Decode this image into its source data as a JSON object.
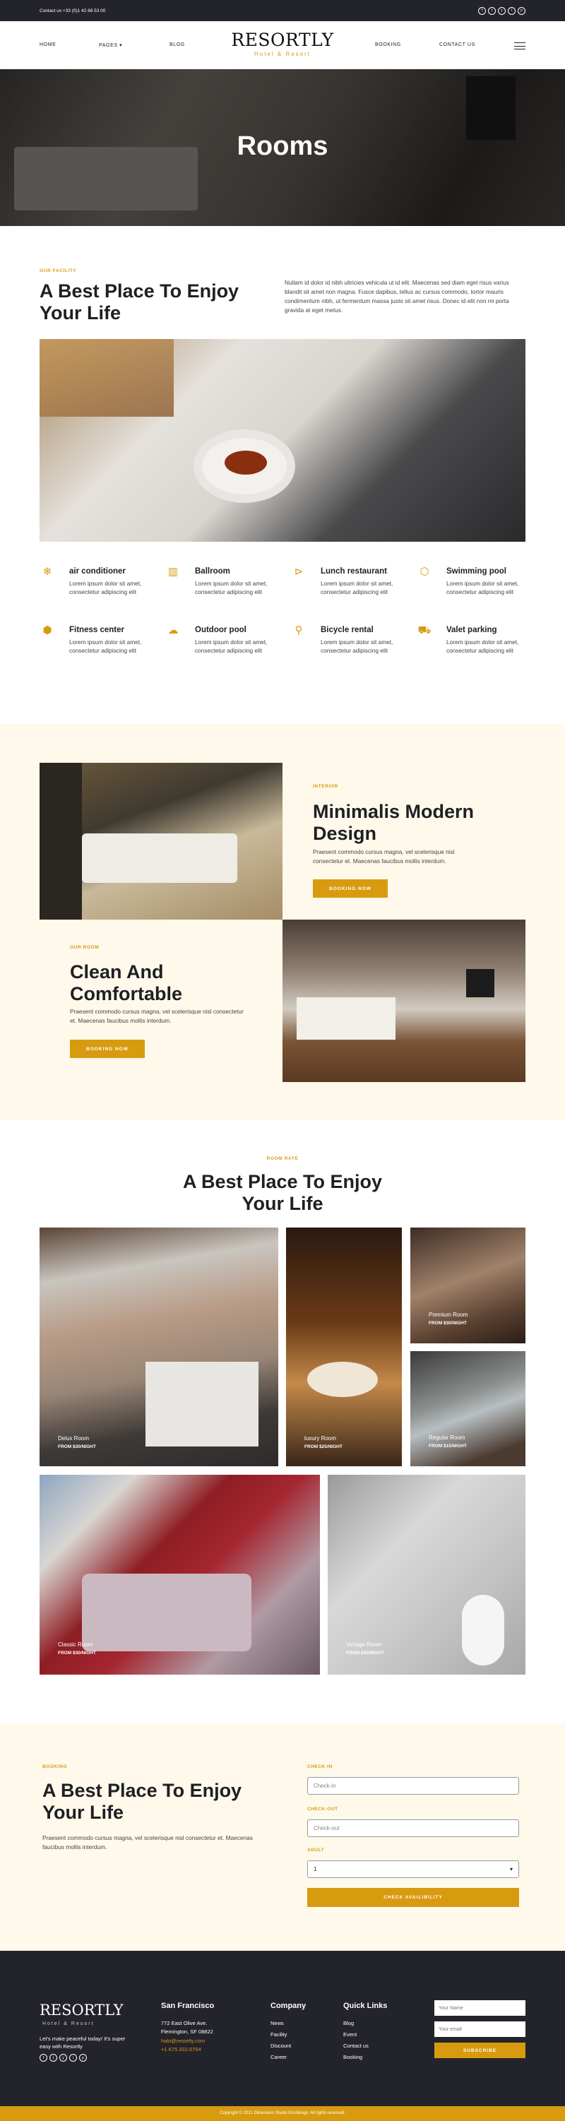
{
  "topbar": {
    "contact": "Contact us +33 (0)1 42 68 53 00",
    "socials": [
      "f",
      "t",
      "y",
      "i",
      "p"
    ]
  },
  "nav": {
    "home": "HOME",
    "pages": "PAGES",
    "blog": "BLOG",
    "booking": "BOOKING",
    "contact": "CONTACT US",
    "logo_name": "RESORTLY",
    "logo_tagline": "Hotel & Resort"
  },
  "hero": {
    "title": "Rooms"
  },
  "facility": {
    "tag": "OUR FACILITY",
    "title": "A Best Place To Enjoy Your Life",
    "text": "Nullam id dolor id nibh ultricies vehicula ut id elit. Maecenas sed diam eget risus varius blandit sit amet non magna. Fusce dapibus, tellus ac cursus commodo, tortor mauris condimentum nibh, ut fermentum massa justo sit amet risus. Donec id elit non mi porta gravida at eget metus.",
    "features": [
      {
        "icon": "snowflake-icon",
        "glyph": "❄",
        "title": "air conditioner",
        "desc": "Lorem ipsum dolor sit amet, consectetur adipiscing elit"
      },
      {
        "icon": "building-icon",
        "glyph": "▥",
        "title": "Ballroom",
        "desc": "Lorem ipsum dolor sit amet, consectetur adipiscing elit"
      },
      {
        "icon": "food-icon",
        "glyph": "⊳",
        "title": "Lunch restaurant",
        "desc": "Lorem ipsum dolor sit amet, consectetur adipiscing elit"
      },
      {
        "icon": "pool-icon",
        "glyph": "⬡",
        "title": "Swimming pool",
        "desc": "Lorem ipsum dolor sit amet, consectetur adipiscing elit"
      },
      {
        "icon": "box-icon",
        "glyph": "⬢",
        "title": "Fitness center",
        "desc": "Lorem ipsum dolor sit amet, consectetur adipiscing elit"
      },
      {
        "icon": "outdoor-icon",
        "glyph": "☁",
        "title": "Outdoor pool",
        "desc": "Lorem ipsum dolor sit amet, consectetur adipiscing elit"
      },
      {
        "icon": "bicycle-icon",
        "glyph": "⚲",
        "title": "Bicycle rental",
        "desc": "Lorem ipsum dolor sit amet, consectetur adipiscing elit"
      },
      {
        "icon": "car-icon",
        "glyph": "⛟",
        "title": "Valet parking",
        "desc": "Lorem ipsum dolor sit amet, consectetur adipiscing elit"
      }
    ]
  },
  "interior": {
    "tag": "INTERIOR",
    "title": "Minimalis Modern Design",
    "text": "Praesent commodo cursus magna, vel scelerisque nisl consectetur et. Maecenas faucibus mollis interdum.",
    "button": "BOOKING NOW"
  },
  "ourroom": {
    "tag": "OUR ROOM",
    "title": "Clean And Comfortable",
    "text": "Praesent commodo cursus magna, vel scelerisque nisl consectetur et. Maecenas faucibus mollis interdum.",
    "button": "BOOKING NOW"
  },
  "rates": {
    "tag": "ROOM RATE",
    "title": "A Best Place To Enjoy Your Life",
    "rooms": [
      {
        "name": "Delux Room",
        "price": "FROM $30/NIGHT"
      },
      {
        "name": "luxury Room",
        "price": "FROM $25/NIGHT"
      },
      {
        "name": "Premium Room",
        "price": "FROM $30/NIGHT"
      },
      {
        "name": "Regular Room",
        "price": "FROM $15/NIGHT"
      },
      {
        "name": "Classic Room",
        "price": "FROM $30/NIGHT"
      },
      {
        "name": "Vintage Room",
        "price": "FROM $30/NIGHT"
      }
    ]
  },
  "booking": {
    "tag": "BOOKING",
    "title": "A Best Place To Enjoy Your Life",
    "text": "Praesent commodo cursus magna, vel scelerisque nisl consectetur et. Maecenas faucibus mollis interdum.",
    "checkin_label": "CHECK-IN",
    "checkin_placeholder": "Check-in",
    "checkout_label": "CHECK-OUT",
    "checkout_placeholder": "Check-out",
    "adult_label": "ADULT",
    "adult_value": "1",
    "button": "CHECK AVAILIBILITY"
  },
  "footer": {
    "logo_name": "RESORTLY",
    "logo_tagline": "Hotel & Resort",
    "about": "Let's make peaceful today! It's super easy with Resortly",
    "city": "San Francisco",
    "address1": "772 East Olive Ave.",
    "address2": "Flemington, SF 08822",
    "email": "halo@resortly.com",
    "phone": "+1 675.332.6754",
    "company_title": "Company",
    "company": [
      "News",
      "Facility",
      "Discount",
      "Career"
    ],
    "links_title": "Quick Links",
    "links": [
      "Blog",
      "Event",
      "Contact us",
      "Booking"
    ],
    "name_placeholder": "Your Name",
    "email_placeholder": "Your email",
    "subscribe": "SUBSCRIBE"
  },
  "copyright": "Copyright © 2021 Dimension Studio Ecodesign. All rights reserved.",
  "colors": {
    "accent": "#d89b10",
    "dark": "#23232b",
    "cream": "#fef9ea"
  }
}
